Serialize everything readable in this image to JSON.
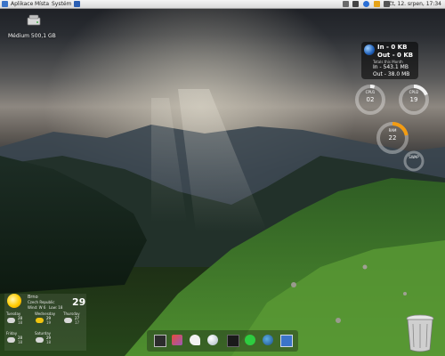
{
  "panel": {
    "menus": [
      "Aplikace",
      "Místa",
      "Systém"
    ],
    "clock": "čt, 12. srpen, 17:34"
  },
  "desktop": {
    "drive_label": "Médium 500,1 GB"
  },
  "network": {
    "in_label": "In - 0 KB",
    "out_label": "Out - 0 KB",
    "month_label": "Totals this Month",
    "month_in": "In - 543.1 MB",
    "month_out": "Out - 38.0 MB"
  },
  "rings": {
    "cpu1": {
      "caption": "CPU1",
      "value": "02",
      "level": 0.05,
      "color": "#f2f2f2"
    },
    "cpu2": {
      "caption": "CPU2",
      "value": "19",
      "level": 0.19,
      "color": "#f2f2f2"
    },
    "ram": {
      "caption": "RAM",
      "value": "22",
      "level": 0.22,
      "color": "#f39c12"
    },
    "swap": {
      "caption": "SWAP",
      "value": "",
      "level": 0.0,
      "color": "#e74c3c"
    }
  },
  "weather": {
    "location": "Brno",
    "subtitle": "Czech Republic",
    "temp": "29",
    "wind_label": "Wind: W 6",
    "low_label": "Low: 18",
    "days": [
      {
        "name": "Tuesday",
        "hi": "28",
        "lo": "18"
      },
      {
        "name": "Wednesday",
        "hi": "29",
        "lo": "19"
      },
      {
        "name": "Thursday",
        "hi": "27",
        "lo": "17"
      },
      {
        "name": "Friday",
        "hi": "28",
        "lo": "18"
      },
      {
        "name": "Saturday",
        "hi": "29",
        "lo": "18"
      }
    ]
  },
  "colors": {
    "accent": "#2a6fd6",
    "panel": "#e8e8e8",
    "grass": "#3f7a2a"
  },
  "dock": {
    "icons": [
      "screen-icon",
      "app-icon",
      "pidgin-icon",
      "globe-icon",
      "terminal-icon",
      "skype-icon",
      "firefox-icon",
      "calendar-icon"
    ]
  }
}
